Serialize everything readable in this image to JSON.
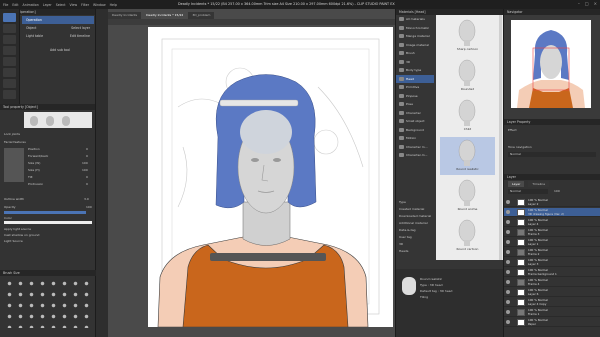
{
  "window": {
    "title": "Deadly Incidents * 15/22 (B4 257.00 x 364.00mm Trim size A4 Size 210.00 x 297.00mm 600dpi 21.6%) - CLIP STUDIO PAINT EX",
    "menu": [
      "File",
      "Edit",
      "Animation",
      "Layer",
      "Select",
      "View",
      "Filter",
      "Window",
      "Help"
    ],
    "controls": [
      "–",
      "□",
      "×"
    ]
  },
  "subtool": {
    "header": "Sub Tool [Operation]",
    "items": [
      "Operation",
      "Object",
      "Light table"
    ],
    "right_labels": [
      "Select layer",
      "Edit timeline"
    ],
    "add_label": "Add sub tool"
  },
  "tool_property": {
    "header": "Tool property [Object]",
    "fields": [
      {
        "label": "Lock joints",
        "value": ""
      },
      {
        "label": "Facial features",
        "value": ""
      },
      {
        "label": "Position",
        "value": "0"
      },
      {
        "label": "Forward/back",
        "value": "0"
      },
      {
        "label": "Size (W)",
        "value": "100"
      },
      {
        "label": "Size (H)",
        "value": "100"
      },
      {
        "label": "Tilt",
        "value": "0"
      },
      {
        "label": "Protrusion",
        "value": "0"
      },
      {
        "label": "Opacity",
        "value": "100"
      },
      {
        "label": "Color",
        "value": ""
      },
      {
        "label": "Apply light source",
        "value": ""
      },
      {
        "label": "Cast shadow on ground",
        "value": ""
      },
      {
        "label": "Light Source",
        "value": ""
      },
      {
        "label": "Outline width",
        "value": "3.0"
      }
    ],
    "brush_panel_label": "Brush Size"
  },
  "tabs": [
    {
      "label": "Deadly Incidents",
      "active": false
    },
    {
      "label": "Deadly Incidents * 15/22",
      "active": true
    },
    {
      "label": "3D_problem",
      "active": false
    }
  ],
  "materials": {
    "header": "Materials [Head]",
    "nav": [
      "All materials",
      "Monochromatic",
      "Manga material",
      "Image material",
      "Brush",
      "3D",
      "Body type",
      "Head",
      "Primitive",
      "Pinpose",
      "Pose",
      "Character",
      "Small object",
      "Background",
      "Motion",
      "Character m...",
      "Character-m..."
    ],
    "items": [
      {
        "label": "Sharp cartoon",
        "selected": false
      },
      {
        "label": "Rounded",
        "selected": false
      },
      {
        "label": "Child",
        "selected": false
      },
      {
        "label": "Round realistic",
        "selected": true
      },
      {
        "label": "Round anime",
        "selected": false
      },
      {
        "label": "Round cartoon",
        "selected": false
      }
    ],
    "info": [
      "Type",
      "Created material",
      "Downloaded material",
      "Additional material",
      "Data-&-tag",
      "User tag",
      "3D",
      "Heads"
    ],
    "detail": {
      "name": "Round realistic",
      "type": "Type : 3D head",
      "tag": "Default tag : 3D head",
      "check": "Tiling"
    }
  },
  "navigator": {
    "header": "Navigator"
  },
  "layer_property": {
    "header": "Layer Property",
    "effect": "Effect",
    "tone": "Tone navigation",
    "blend": "Normal",
    "opacity": "100"
  },
  "layers": {
    "header": "Layer",
    "tabs": [
      "Layer",
      "Timeline"
    ],
    "blend": "Normal",
    "opacity": "100",
    "list": [
      {
        "pct": "100 % Normal",
        "name": "Layer 2",
        "selected": false,
        "folder": false
      },
      {
        "pct": "100 % Normal",
        "name": "3D drawing figure (Ver. 2)",
        "selected": true,
        "folder": false
      },
      {
        "pct": "100 % Normal",
        "name": "Layer 4",
        "selected": false,
        "folder": false
      },
      {
        "pct": "100 % Normal",
        "name": "Frame 3",
        "selected": false,
        "folder": true
      },
      {
        "pct": "100 % Normal",
        "name": "Layer 1",
        "selected": false,
        "folder": false
      },
      {
        "pct": "100 % Normal",
        "name": "Frame 2",
        "selected": false,
        "folder": true
      },
      {
        "pct": "100 % Normal",
        "name": "Layer 3",
        "selected": false,
        "folder": false
      },
      {
        "pct": "100 % Normal",
        "name": "Frame background 1",
        "selected": false,
        "folder": false
      },
      {
        "pct": "100 % Normal",
        "name": "Frame 4",
        "selected": false,
        "folder": true
      },
      {
        "pct": "100 % Normal",
        "name": "Layer 6",
        "selected": false,
        "folder": false
      },
      {
        "pct": "100 % Normal",
        "name": "Layer 4 Copy",
        "selected": false,
        "folder": false
      },
      {
        "pct": "100 % Normal",
        "name": "Frame 1",
        "selected": false,
        "folder": true
      },
      {
        "pct": "100 % Normal",
        "name": "Paper",
        "selected": false,
        "folder": false
      }
    ]
  },
  "colors": {
    "accent": "#4b74b5",
    "panel": "#333333",
    "hair": "#5b79c4",
    "skin": "#f4cdb6",
    "shirt": "#c9661c",
    "head": "#d6d6d6"
  }
}
